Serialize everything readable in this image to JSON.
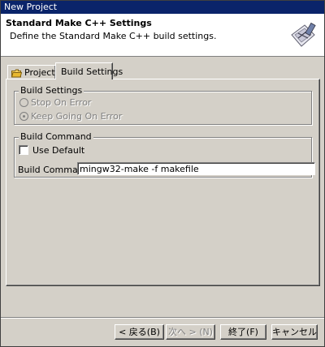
{
  "window": {
    "title": "New Project"
  },
  "banner": {
    "title": "Standard Make C++ Settings",
    "description": "Define the Standard Make C++ build settings."
  },
  "tabs": [
    {
      "label": "Projects",
      "icon": "folder-icon",
      "selected": false
    },
    {
      "label": "Build Settings",
      "selected": true
    }
  ],
  "build_settings": {
    "legend": "Build Settings",
    "options": [
      {
        "label": "Stop On Error",
        "checked": false,
        "enabled": false
      },
      {
        "label": "Keep Going On Error",
        "checked": true,
        "enabled": false
      }
    ]
  },
  "build_command": {
    "legend": "Build Command",
    "use_default_label": "Use Default",
    "use_default_checked": false,
    "field_label": "Build Command:",
    "field_value": "mingw32-make -f makefile"
  },
  "buttons": {
    "back": "< 戻る(B)",
    "next": "次へ > (N)",
    "finish": "終了(F)",
    "cancel": "キャンセル"
  },
  "colors": {
    "titlebar": "#0a246a",
    "dialog_bg": "#d4d0c8",
    "banner_bg": "#ffffff"
  }
}
